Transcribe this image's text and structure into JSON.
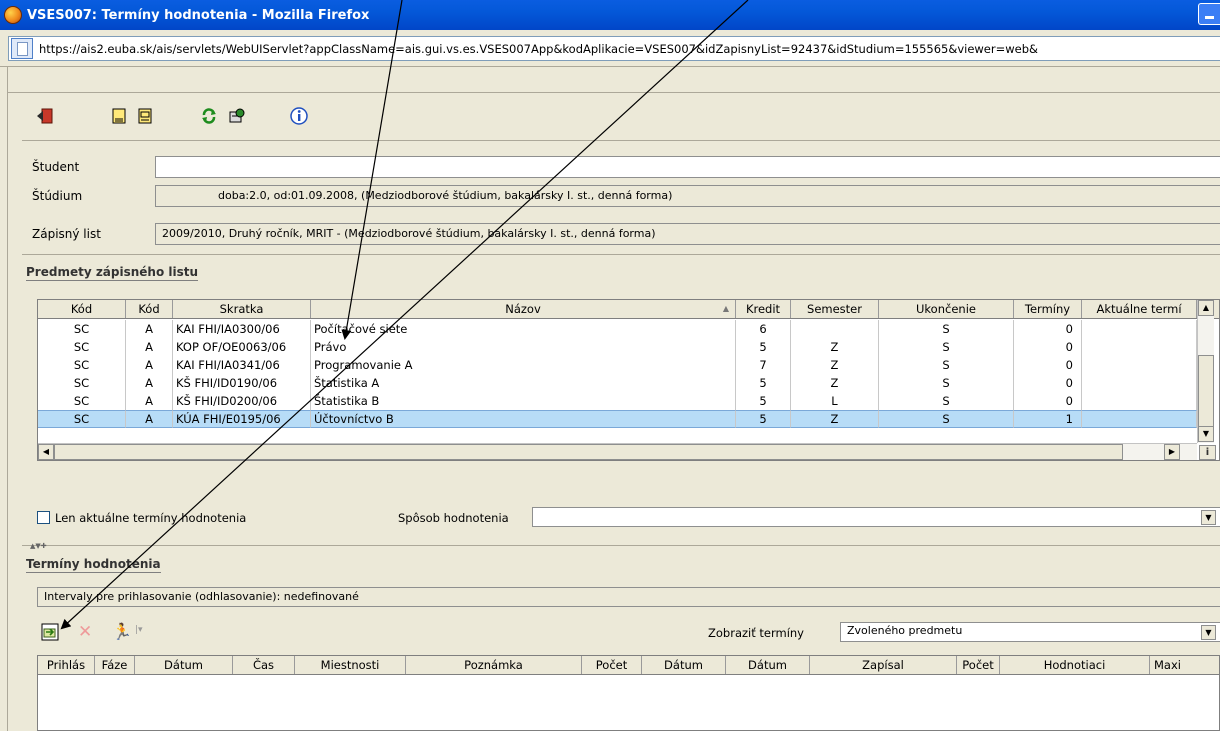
{
  "window": {
    "title": "VSES007: Termíny hodnotenia - Mozilla Firefox"
  },
  "browser": {
    "url": "https://ais2.euba.sk/ais/servlets/WebUIServlet?appClassName=ais.gui.vs.es.VSES007App&kodAplikacie=VSES007&idZapisnyList=92437&idStudium=155565&viewer=web&"
  },
  "toolbar": {
    "icons": [
      "exit-icon",
      "document-icon",
      "document-print-icon",
      "refresh-icon",
      "tools-icon",
      "info-icon"
    ]
  },
  "student_form": {
    "student_label": "Študent",
    "student_value": "",
    "studium_label": "Štúdium",
    "studium_value": "doba:2.0, od:01.09.2008, (Medziodborové štúdium, bakalársky I. st., denná forma)",
    "zapisny_label": "Zápisný list",
    "zapisny_value": "2009/2010, Druhý ročník, MRIT - (Medziodborové štúdium, bakalársky I. st., denná forma)"
  },
  "predmety": {
    "section_title": "Predmety zápisného listu",
    "columns": [
      "Kód",
      "Kód",
      "Skratka",
      "Názov",
      "Kredit",
      "Semester",
      "Ukončenie",
      "Termíny",
      "Aktuálne termí"
    ],
    "rows": [
      {
        "kod1": "SC",
        "kod2": "A",
        "skratka": "KAI FHI/IA0300/06",
        "nazov": "Počítačové siete",
        "kredit": "6",
        "semester": "",
        "ukoncenie": "S",
        "terminy": "0"
      },
      {
        "kod1": "SC",
        "kod2": "A",
        "skratka": "KOP OF/OE0063/06",
        "nazov": "Právo",
        "kredit": "5",
        "semester": "Z",
        "ukoncenie": "S",
        "terminy": "0"
      },
      {
        "kod1": "SC",
        "kod2": "A",
        "skratka": "KAI FHI/IA0341/06",
        "nazov": "Programovanie A",
        "kredit": "7",
        "semester": "Z",
        "ukoncenie": "S",
        "terminy": "0"
      },
      {
        "kod1": "SC",
        "kod2": "A",
        "skratka": "KŠ FHI/ID0190/06",
        "nazov": "Štatistika A",
        "kredit": "5",
        "semester": "Z",
        "ukoncenie": "S",
        "terminy": "0"
      },
      {
        "kod1": "SC",
        "kod2": "A",
        "skratka": "KŠ FHI/ID0200/06",
        "nazov": "Štatistika B",
        "kredit": "5",
        "semester": "L",
        "ukoncenie": "S",
        "terminy": "0"
      },
      {
        "kod1": "SC",
        "kod2": "A",
        "skratka": "KÚA FHI/E0195/06",
        "nazov": "Účtovníctvo B",
        "kredit": "5",
        "semester": "Z",
        "ukoncenie": "S",
        "terminy": "1"
      }
    ],
    "selected_row": 5
  },
  "filter": {
    "checkbox_label": "Len aktuálne termíny hodnotenia",
    "checked": false,
    "sposob_label": "Spôsob hodnotenia",
    "sposob_value": ""
  },
  "terminy": {
    "section_title": "Termíny hodnotenia",
    "interval_text": "Intervaly pre prihlasovanie (odhlasovanie): nedefinované",
    "zobrazit_label": "Zobraziť termíny",
    "zobrazit_value": "Zvoleného predmetu",
    "columns": [
      "Prihlás",
      "Fáze",
      "Dátum",
      "Čas",
      "Miestnosti",
      "Poznámka",
      "Počet",
      "Dátum",
      "Dátum",
      "Zapísal",
      "Počet",
      "Hodnotiaci",
      "Maxi"
    ]
  },
  "colors": {
    "titlebar": "#0458d8",
    "chrome": "#ece9d8",
    "selection": "#b7dcf7"
  }
}
